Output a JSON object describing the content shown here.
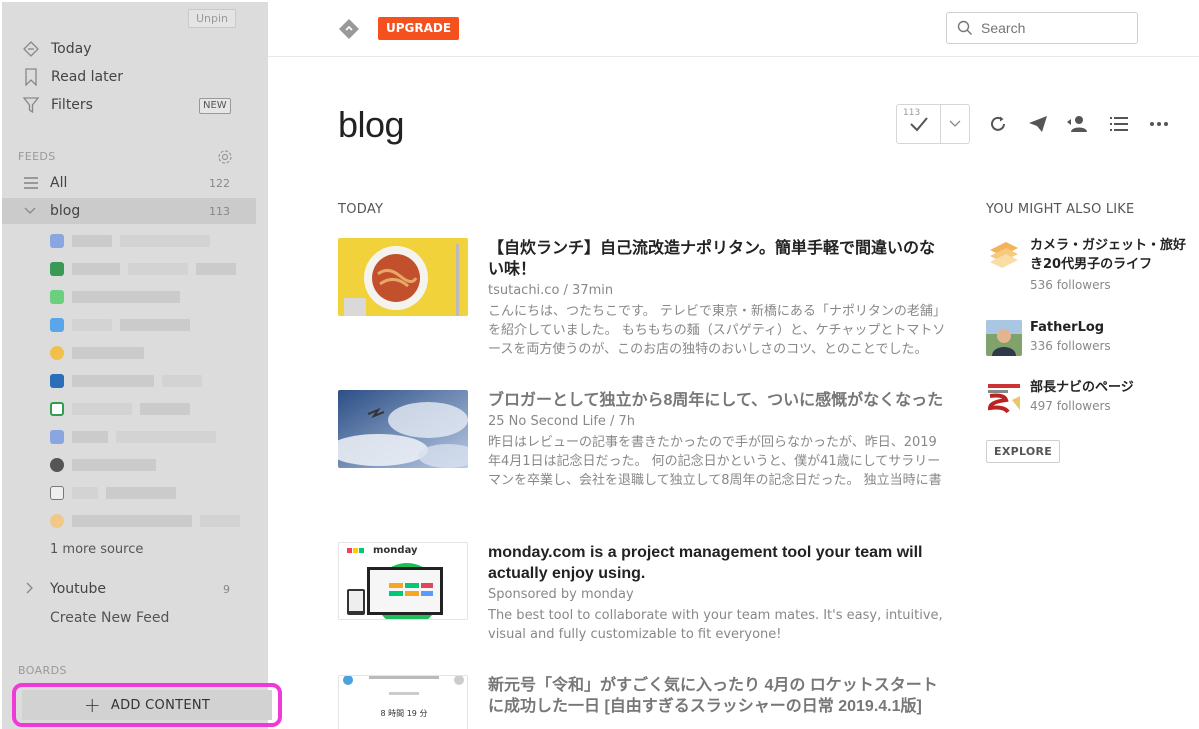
{
  "sidebar": {
    "unpin": "Unpin",
    "nav": [
      {
        "label": "Today",
        "icon": "today-icon"
      },
      {
        "label": "Read later",
        "icon": "bookmark-icon"
      },
      {
        "label": "Filters",
        "icon": "filter-icon"
      }
    ],
    "new_badge": "NEW",
    "feeds_label": "FEEDS",
    "feeds": [
      {
        "label": "All",
        "count": "122"
      },
      {
        "label": "blog",
        "count": "113"
      }
    ],
    "more_source": "1 more source",
    "youtube": {
      "label": "Youtube",
      "count": "9"
    },
    "create_feed": "Create New Feed",
    "boards_label": "BOARDS",
    "add_content": "ADD CONTENT"
  },
  "header": {
    "upgrade": "UPGRADE",
    "search_placeholder": "Search"
  },
  "main": {
    "title": "blog",
    "unread_count": "113",
    "today_label": "TODAY",
    "articles": [
      {
        "title": "【自炊ランチ】自己流改造ナポリタン。簡単手軽で間違いのない味！",
        "meta": "tsutachi.co / 37min",
        "snippet": "こんにちは、つたちこです。 テレビで東京・新橋にある「ナポリタンの老舗」を紹介していました。 もちもちの麺（スパゲティ）と、ケチャップとトマトソースを両方使うのが、このお店の独特のおいしさのコツ、とのことでした。"
      },
      {
        "title": "ブロガーとして独立から8周年にして、ついに感慨がなくなった",
        "meta": "25   No Second Life / 7h",
        "snippet": "昨日はレビューの記事を書きたかったので手が回らなかったが、昨日、2019年4月1日は記念日だった。 何の記念日かというと、僕が41歳にしてサラリーマンを卒業し、会社を退職して独立して8周年の記念日だった。 独立当時に書"
      },
      {
        "title": "monday.com is a project management tool your team will actually enjoy using.",
        "meta": "Sponsored by monday",
        "snippet": "The best tool to collaborate with your team mates. It's easy, intuitive, visual and fully customizable to fit everyone!"
      },
      {
        "title": "新元号「令和」がすごく気に入ったり 4月の ロケットスタートに成功した一日 [自由すぎるスラッシャーの日常 2019.4.1版]",
        "meta": "",
        "snippet": ""
      }
    ],
    "monday_logo": "monday",
    "monday_thumb_text": "8 時間 19 分"
  },
  "right": {
    "label": "YOU MIGHT ALSO LIKE",
    "recs": [
      {
        "name": "カメラ・ガジェット・旅好き20代男子のライフ",
        "followers": "536 followers"
      },
      {
        "name": "FatherLog",
        "followers": "336 followers"
      },
      {
        "name": "部長ナビのページ",
        "followers": "497 followers"
      }
    ],
    "explore": "EXPLORE"
  },
  "colors": {
    "upgrade": "#f4511e",
    "sidebar_bg": "#dcdcdc",
    "highlight_border": "#f03ad8"
  }
}
